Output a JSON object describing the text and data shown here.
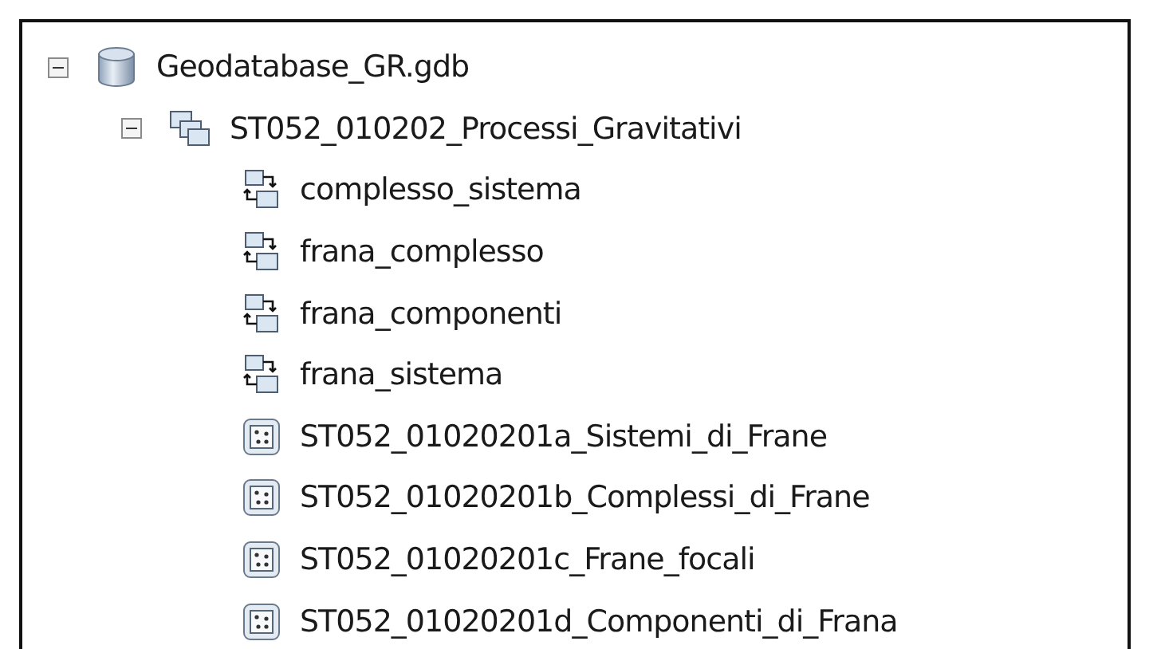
{
  "tree": [
    {
      "label": "Geodatabase_GR.gdb",
      "kind": "geodatabase",
      "expanded": true,
      "children": [
        {
          "label": "ST052_010202_Processi_Gravitativi",
          "kind": "dataset",
          "expanded": true,
          "children": [
            {
              "label": "complesso_sistema",
              "kind": "relationship"
            },
            {
              "label": "frana_complesso",
              "kind": "relationship"
            },
            {
              "label": "frana_componenti",
              "kind": "relationship"
            },
            {
              "label": "frana_sistema",
              "kind": "relationship"
            },
            {
              "label": "ST052_01020201a_Sistemi_di_Frane",
              "kind": "featureclass"
            },
            {
              "label": "ST052_01020201b_Complessi_di_Frane",
              "kind": "featureclass"
            },
            {
              "label": "ST052_01020201c_Frane_focali",
              "kind": "featureclass"
            },
            {
              "label": "ST052_01020201d_Componenti_di_Frana",
              "kind": "featureclass"
            }
          ]
        }
      ]
    }
  ]
}
